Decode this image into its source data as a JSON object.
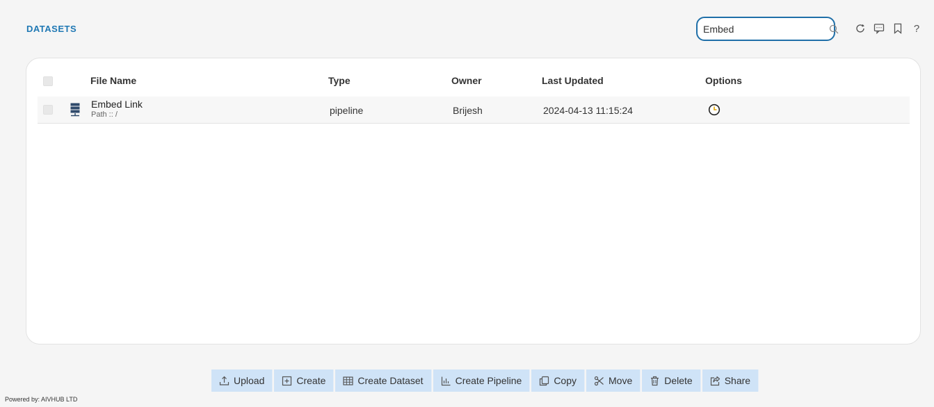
{
  "header": {
    "title": "DATASETS",
    "search": {
      "value": "Embed",
      "placeholder": ""
    },
    "icons": [
      "refresh-icon",
      "comment-icon",
      "bookmark-icon",
      "help-icon"
    ],
    "help_glyph": "?"
  },
  "table": {
    "columns": [
      "File Name",
      "Type",
      "Owner",
      "Last Updated",
      "Options"
    ],
    "rows": [
      {
        "name": "Embed Link",
        "path": "Path :: /",
        "type": "pipeline",
        "owner": "Brijesh",
        "updated": "2024-04-13 11:15:24"
      }
    ]
  },
  "toolbar": {
    "upload": "Upload",
    "create": "Create",
    "create_dataset": "Create Dataset",
    "create_pipeline": "Create Pipeline",
    "copy": "Copy",
    "move": "Move",
    "delete": "Delete",
    "share": "Share"
  },
  "footer": {
    "text": "Powered by: AIVHUB LTD"
  },
  "colors": {
    "accent": "#1f78b4",
    "toolbar_bg": "#cfe3f7",
    "search_border": "#1f6fa8"
  }
}
